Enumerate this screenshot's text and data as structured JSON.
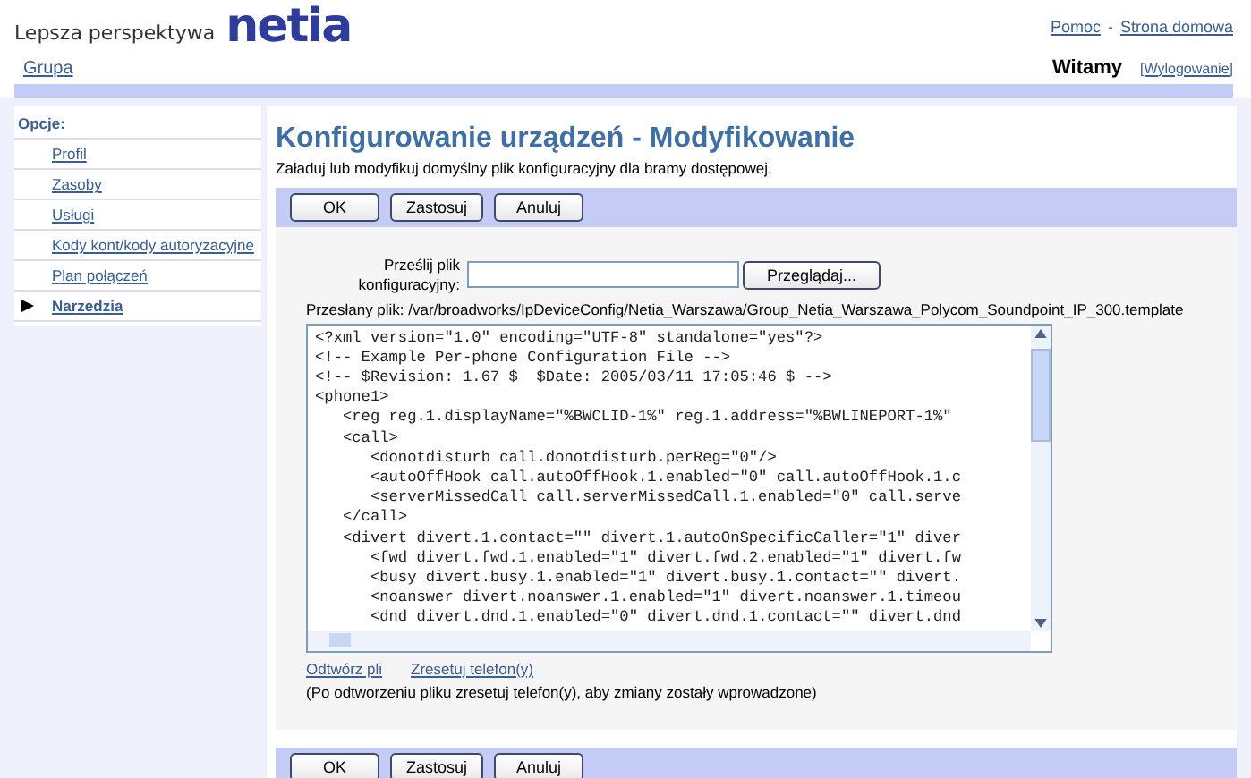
{
  "header": {
    "tagline": "Lepsza perspektywa",
    "logo": "netia",
    "group_link": "Grupa",
    "top_links": [
      "Pomoc",
      "Strona domowa"
    ],
    "separator": "-",
    "welcome": "Witamy",
    "logout": "[Wylogowanie]"
  },
  "sidebar": {
    "title": "Opcje:",
    "items": [
      {
        "label": "Profil",
        "selected": false
      },
      {
        "label": "Zasoby",
        "selected": false
      },
      {
        "label": "Usługi",
        "selected": false
      },
      {
        "label": "Kody kont/kody autoryzacyjne",
        "selected": false
      },
      {
        "label": "Plan połączeń",
        "selected": false
      },
      {
        "label": "Narzedzia",
        "selected": true
      }
    ]
  },
  "main": {
    "title": "Konfigurowanie urządzeń - Modyfikowanie",
    "description": "Załaduj lub modyfikuj domyślny plik konfiguracyjny dla bramy dostępowej.",
    "top_buttons": [
      "OK",
      "Zastosuj",
      "Anuluj"
    ],
    "upload_label": "Prześlij plik konfiguracyjny:",
    "browse_button": "Przeglądaj...",
    "uploaded_file": "Przesłany plik: /var/broadworks/IpDeviceConfig/Netia_Warszawa/Group_Netia_Warszawa_Polycom_Soundpoint_IP_300.template",
    "code_lines": [
      "<?xml version=\"1.0\" encoding=\"UTF-8\" standalone=\"yes\"?>",
      "<!-- Example Per-phone Configuration File -->",
      "<!-- $Revision: 1.67 $  $Date: 2005/03/11 17:05:46 $ -->",
      "<phone1>",
      "   <reg reg.1.displayName=\"%BWCLID-1%\" reg.1.address=\"%BWLINEPORT-1%\"",
      "   <call>",
      "      <donotdisturb call.donotdisturb.perReg=\"0\"/>",
      "      <autoOffHook call.autoOffHook.1.enabled=\"0\" call.autoOffHook.1.c",
      "      <serverMissedCall call.serverMissedCall.1.enabled=\"0\" call.serve",
      "   </call>",
      "   <divert divert.1.contact=\"\" divert.1.autoOnSpecificCaller=\"1\" diver",
      "      <fwd divert.fwd.1.enabled=\"1\" divert.fwd.2.enabled=\"1\" divert.fw",
      "      <busy divert.busy.1.enabled=\"1\" divert.busy.1.contact=\"\" divert.",
      "      <noanswer divert.noanswer.1.enabled=\"1\" divert.noanswer.1.timeou",
      "      <dnd divert.dnd.1.enabled=\"0\" divert.dnd.1.contact=\"\" divert.dnd"
    ],
    "links": [
      "Odtwórz pli",
      "Zresetuj telefon(y)"
    ],
    "note": "(Po odtworzeniu pliku zresetuj telefon(y), aby zmiany zostały wprowadzone)",
    "bottom_buttons": [
      "OK",
      "Zastosuj",
      "Anuluj"
    ]
  }
}
